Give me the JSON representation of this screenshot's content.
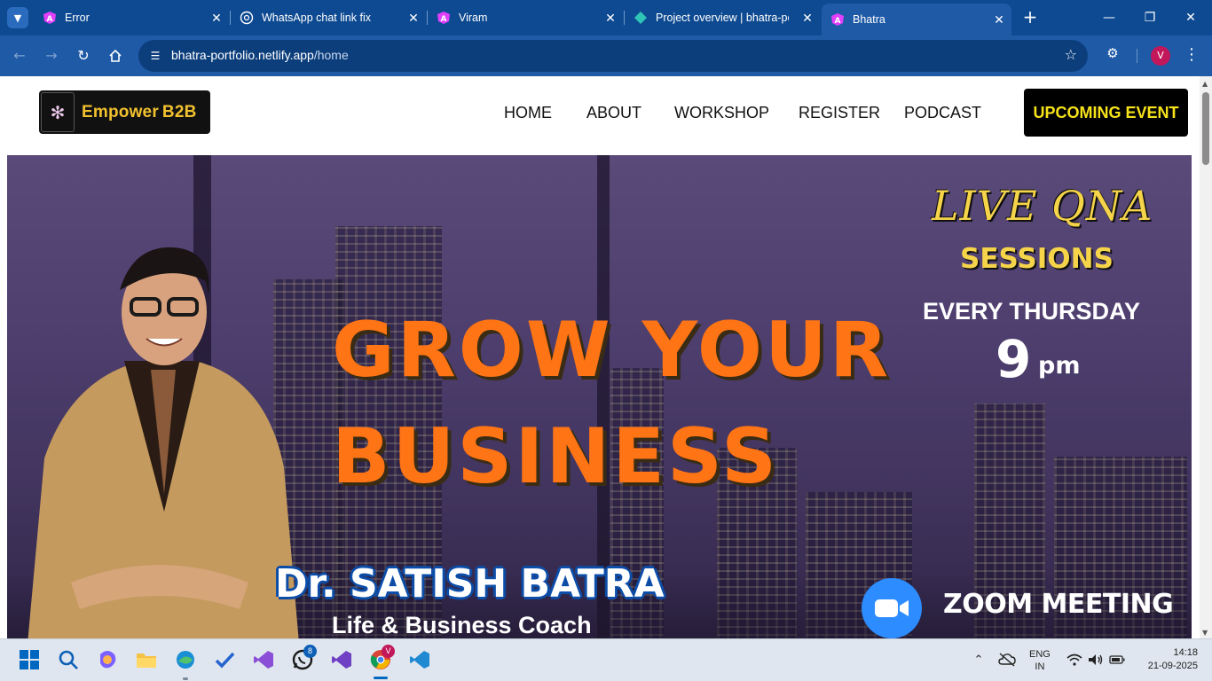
{
  "browser": {
    "tabs": [
      {
        "title": "Error",
        "favicon": "angular-icon",
        "active": false
      },
      {
        "title": "WhatsApp chat link fix",
        "favicon": "chatgpt-icon",
        "active": false
      },
      {
        "title": "Viram",
        "favicon": "angular-icon",
        "active": false
      },
      {
        "title": "Project overview | bhatra-po",
        "favicon": "netlify-icon",
        "active": false
      },
      {
        "title": "Bhatra",
        "favicon": "angular-icon",
        "active": true
      }
    ],
    "url_host": "bhatra-portfolio.netlify.app",
    "url_path": "/home",
    "profile_initial": "V"
  },
  "site": {
    "logo_text": "Empower",
    "logo_suffix": "B2B",
    "nav": [
      "HOME",
      "ABOUT",
      "WORKSHOP",
      "REGISTER",
      "PODCAST"
    ],
    "cta": "UPCOMING EVENT"
  },
  "hero": {
    "headline_line1": "GROW YOUR",
    "headline_line2": "BUSINESS",
    "live_title": "LIVE QNA",
    "sessions": "SESSIONS",
    "schedule_day": "EVERY THURSDAY",
    "schedule_time_num": "9",
    "schedule_time_unit": "pm",
    "speaker_name": "Dr. SATISH BATRA",
    "speaker_role": "Life & Business Coach",
    "platform": "ZOOM MEETING"
  },
  "taskbar": {
    "whatsapp_badge": "8",
    "chrome_badge": "V",
    "lang_line1": "ENG",
    "lang_line2": "IN",
    "time": "14:18",
    "date": "21-09-2025"
  },
  "colors": {
    "tab_strip": "#0e4a91",
    "toolbar": "#1f5aa6",
    "headline": "#ff7414",
    "accent_yellow": "#f5d44a",
    "cta_text": "#f6e21a",
    "zoom_blue": "#2d8cff"
  }
}
